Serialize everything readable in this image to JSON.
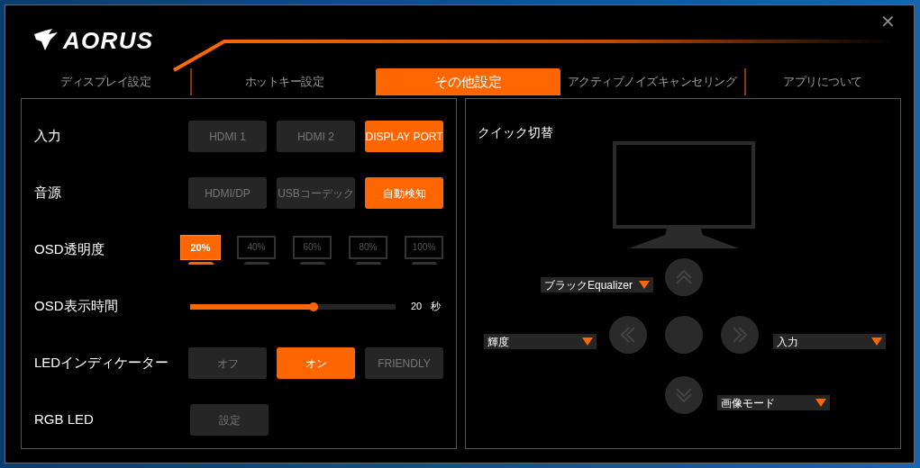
{
  "window": {
    "logo_text": "AORUS",
    "close": "✕"
  },
  "tabs": [
    {
      "label": "ディスプレイ設定",
      "selected": false
    },
    {
      "label": "ホットキー設定",
      "selected": false
    },
    {
      "label": "その他設定",
      "selected": true
    },
    {
      "label": "アクティブノイズキャンセリング",
      "selected": false
    },
    {
      "label": "アプリについて",
      "selected": false
    }
  ],
  "settings": [
    {
      "kind": "buttons",
      "label": "入力",
      "options": [
        {
          "label": "HDMI 1",
          "selected": false
        },
        {
          "label": "HDMI 2",
          "selected": false
        },
        {
          "label": "DISPLAY PORT",
          "selected": true
        }
      ]
    },
    {
      "kind": "buttons",
      "label": "音源",
      "options": [
        {
          "label": "HDMI/DP",
          "selected": false
        },
        {
          "label": "USBコーデック",
          "selected": false
        },
        {
          "label": "自動検知",
          "selected": true
        }
      ]
    },
    {
      "kind": "transparency",
      "label": "OSD透明度",
      "options": [
        {
          "label": "20%",
          "selected": true
        },
        {
          "label": "40%",
          "selected": false
        },
        {
          "label": "60%",
          "selected": false
        },
        {
          "label": "80%",
          "selected": false
        },
        {
          "label": "100%",
          "selected": false
        }
      ]
    },
    {
      "kind": "slider",
      "label": "OSD表示時間",
      "level": 0.6,
      "value": "20",
      "unit": "秒"
    },
    {
      "kind": "buttons",
      "label": "LEDインディケーター",
      "options": [
        {
          "label": "オフ",
          "selected": false
        },
        {
          "label": "オン",
          "selected": true
        },
        {
          "label": "FRIENDLY",
          "selected": false
        }
      ]
    },
    {
      "kind": "buttons",
      "label": "RGB LED",
      "options": [
        {
          "label": "設定",
          "selected": false
        }
      ]
    }
  ],
  "quick_switch": {
    "title": "クイック切替",
    "up": "ブラックEqualizer",
    "left": "輝度",
    "right": "入力",
    "down": "画像モード"
  }
}
